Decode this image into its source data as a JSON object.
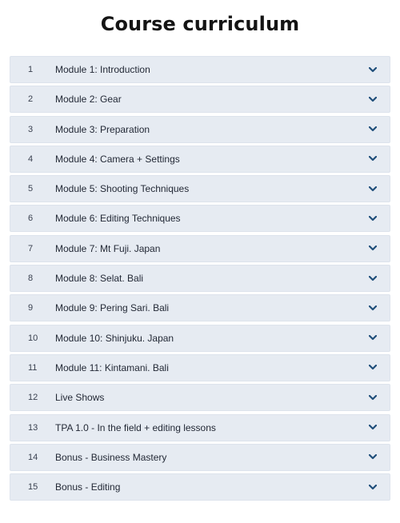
{
  "page": {
    "title": "Course curriculum"
  },
  "colors": {
    "row_background": "#e6ebf2",
    "chevron": "#1f4e7a",
    "title": "#141414"
  },
  "curriculum": {
    "items": [
      {
        "number": "1",
        "label": "Module 1: Introduction",
        "icon": "chevron-down-icon"
      },
      {
        "number": "2",
        "label": "Module 2: Gear",
        "icon": "chevron-down-icon"
      },
      {
        "number": "3",
        "label": "Module 3: Preparation",
        "icon": "chevron-down-icon"
      },
      {
        "number": "4",
        "label": "Module 4: Camera + Settings",
        "icon": "chevron-down-icon"
      },
      {
        "number": "5",
        "label": "Module 5: Shooting Techniques",
        "icon": "chevron-down-icon"
      },
      {
        "number": "6",
        "label": "Module 6: Editing Techniques",
        "icon": "chevron-down-icon"
      },
      {
        "number": "7",
        "label": "Module 7: Mt Fuji. Japan",
        "icon": "chevron-down-icon"
      },
      {
        "number": "8",
        "label": "Module 8: Selat. Bali",
        "icon": "chevron-down-icon"
      },
      {
        "number": "9",
        "label": "Module 9: Pering Sari. Bali",
        "icon": "chevron-down-icon"
      },
      {
        "number": "10",
        "label": "Module 10: Shinjuku. Japan",
        "icon": "chevron-down-icon"
      },
      {
        "number": "11",
        "label": "Module 11: Kintamani. Bali",
        "icon": "chevron-down-icon"
      },
      {
        "number": "12",
        "label": "Live Shows",
        "icon": "chevron-down-icon"
      },
      {
        "number": "13",
        "label": "TPA 1.0 - In the field + editing lessons",
        "icon": "chevron-down-icon"
      },
      {
        "number": "14",
        "label": "Bonus - Business Mastery",
        "icon": "chevron-down-icon"
      },
      {
        "number": "15",
        "label": "Bonus - Editing",
        "icon": "chevron-down-icon"
      }
    ]
  }
}
